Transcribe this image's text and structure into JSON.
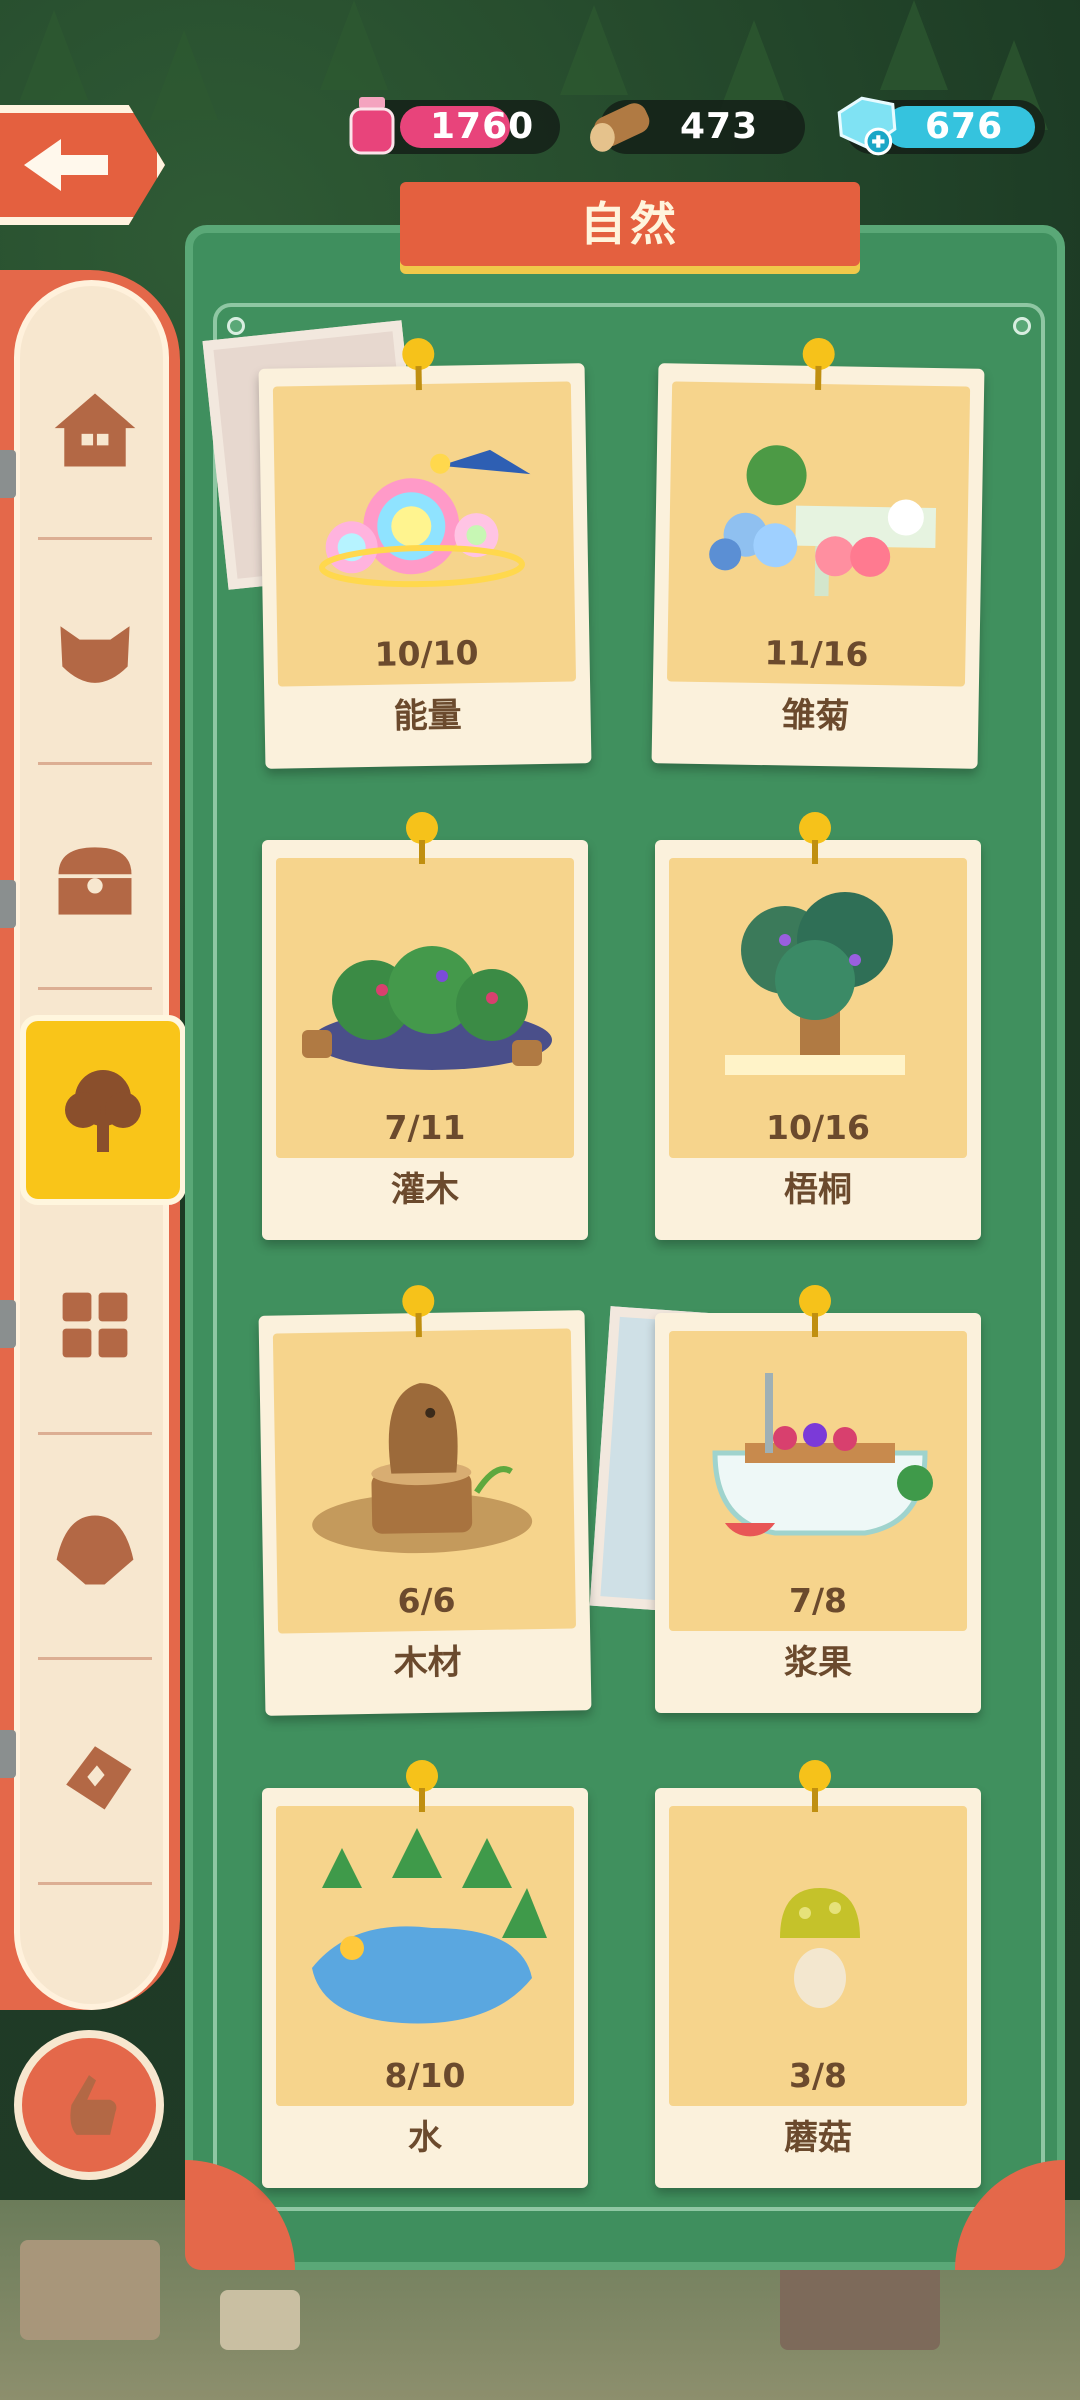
{
  "resources": [
    {
      "name": "ink",
      "value": "1760",
      "icon": "ink-bottle-icon",
      "color": "#e8447b"
    },
    {
      "name": "wood",
      "value": "473",
      "icon": "wood-log-icon",
      "color": "#8b5a2b"
    },
    {
      "name": "gems",
      "value": "676",
      "icon": "gem-icon",
      "color": "#35c3de"
    }
  ],
  "panel": {
    "title": "自然"
  },
  "tabs": [
    {
      "icon": "house-icon",
      "active": false
    },
    {
      "icon": "cat-icon",
      "active": false
    },
    {
      "icon": "chest-icon",
      "active": false
    },
    {
      "icon": "tree-icon",
      "active": true
    },
    {
      "icon": "grid-icon",
      "active": false
    },
    {
      "icon": "shell-icon",
      "active": false
    },
    {
      "icon": "ticket-icon",
      "active": false
    }
  ],
  "cards": [
    {
      "count": "10/10",
      "label": "能量"
    },
    {
      "count": "11/16",
      "label": "雏菊"
    },
    {
      "count": "7/11",
      "label": "灌木"
    },
    {
      "count": "10/16",
      "label": "梧桐"
    },
    {
      "count": "6/6",
      "label": "木材"
    },
    {
      "count": "7/8",
      "label": "浆果"
    },
    {
      "count": "8/10",
      "label": "水"
    },
    {
      "count": "3/8",
      "label": "蘑菇"
    }
  ],
  "colors": {
    "accent": "#e4603f",
    "panel": "#3f8f5e",
    "active_tab": "#f9c519",
    "text": "#6b4a2d"
  }
}
